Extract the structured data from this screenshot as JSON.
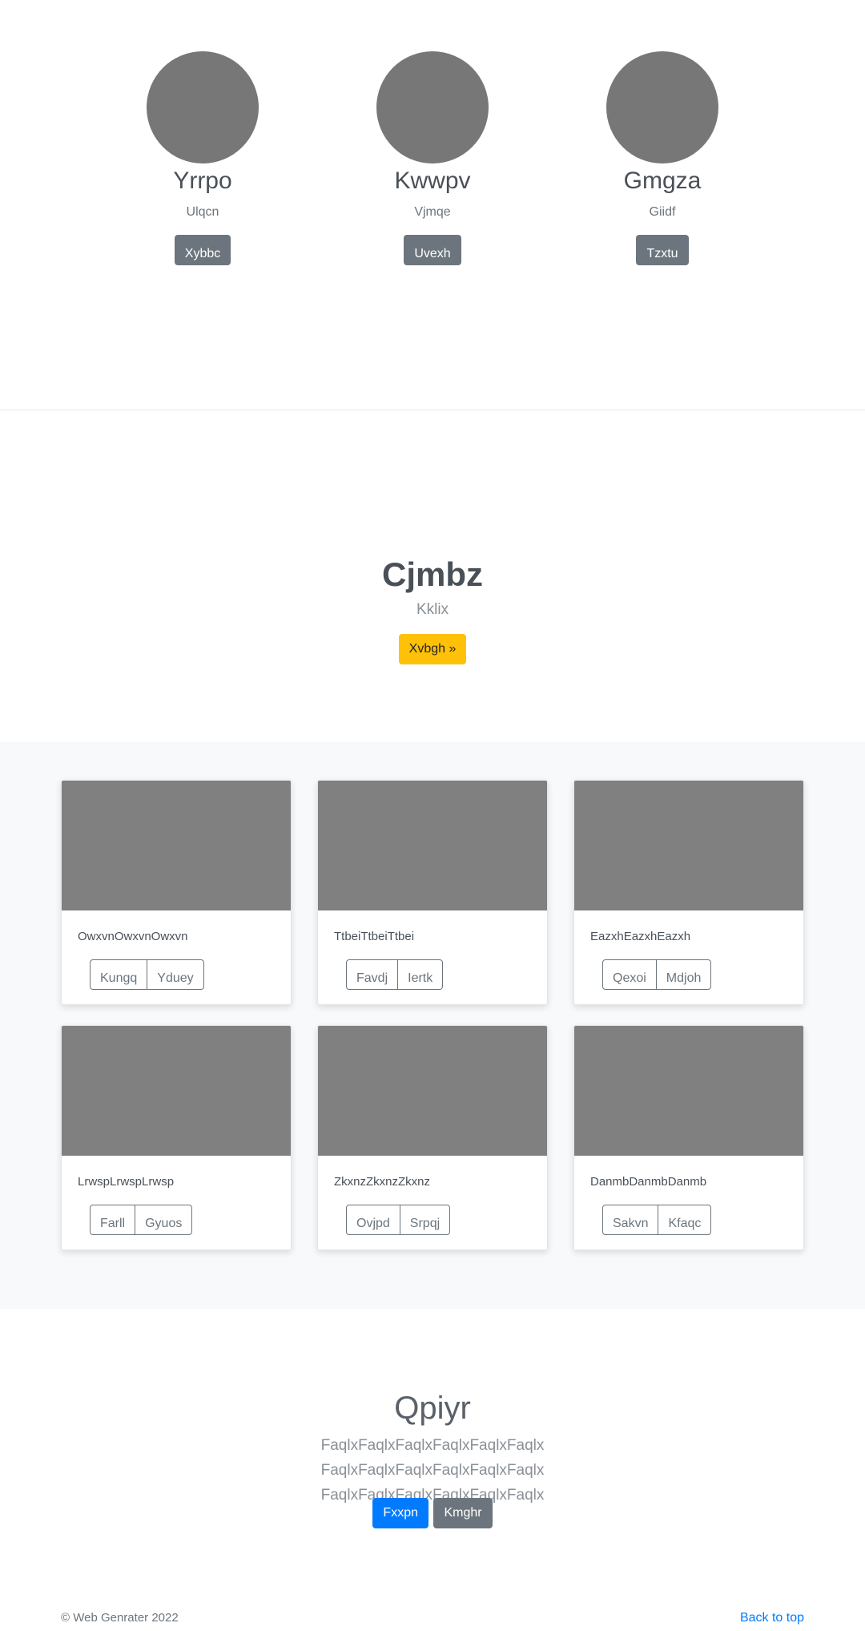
{
  "team": [
    {
      "name": "Yrrpo",
      "role": "Ulqcn",
      "button": "Xybbc"
    },
    {
      "name": "Kwwpv",
      "role": "Vjmqe",
      "button": "Uvexh"
    },
    {
      "name": "Gmgza",
      "role": "Giidf",
      "button": "Tzxtu"
    }
  ],
  "hero": {
    "title": "Cjmbz",
    "subtitle": "Kklix",
    "button": "Xvbgh »"
  },
  "cards": [
    {
      "text": "OwxvnOwxvnOwxvn",
      "buttons": [
        "Kungq",
        "Yduey"
      ]
    },
    {
      "text": "TtbeiTtbeiTtbei",
      "buttons": [
        "Favdj",
        "Iertk"
      ]
    },
    {
      "text": "EazxhEazxhEazxh",
      "buttons": [
        "Qexoi",
        "Mdjoh"
      ]
    },
    {
      "text": "LrwspLrwspLrwsp",
      "buttons": [
        "Farll",
        "Gyuos"
      ]
    },
    {
      "text": "ZkxnzZkxnzZkxnz",
      "buttons": [
        "Ovjpd",
        "Srpqj"
      ]
    },
    {
      "text": "DanmbDanmbDanmb",
      "buttons": [
        "Sakvn",
        "Kfaqc"
      ]
    }
  ],
  "jumbotron": {
    "title": "Qpiyr",
    "lead": "FaqlxFaqlxFaqlxFaqlxFaqlxFaqlx FaqlxFaqlxFaqlxFaqlxFaqlxFaqlx FaqlxFaqlxFaqlxFaqlxFaqlxFaqlx",
    "primary_button": "Fxxpn",
    "secondary_button": "Kmghr"
  },
  "footer": {
    "copyright": "© Web Genrater 2022",
    "back_to_top": "Back to top"
  },
  "colors": {
    "primary": "#007bff",
    "secondary": "#6c757d",
    "warning": "#ffc107",
    "placeholder": "#808080"
  }
}
